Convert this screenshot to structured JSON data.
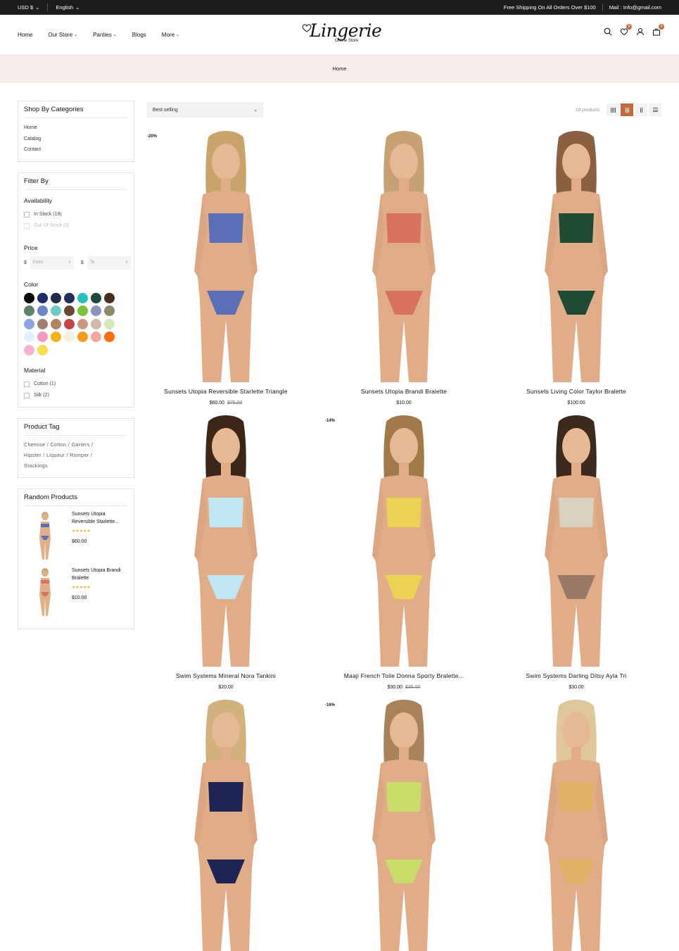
{
  "topbar": {
    "currency": "USD $",
    "language": "English",
    "shipping": "Free Shipping On All Orders Over $100",
    "mail": "Mail : Info@gmail.com"
  },
  "header": {
    "nav": [
      {
        "label": "Home",
        "dropdown": false
      },
      {
        "label": "Our Store",
        "dropdown": true
      },
      {
        "label": "Panties",
        "dropdown": true
      },
      {
        "label": "Blogs",
        "dropdown": false
      },
      {
        "label": "More",
        "dropdown": true
      }
    ],
    "logo_title": "Lingerie",
    "logo_subtitle": "Online Store",
    "wishlist_count": "0",
    "cart_count": "0",
    "accent": "#c8683e"
  },
  "breadcrumb": "Home",
  "sidebar": {
    "categories": {
      "title": "Shop By Categories",
      "links": [
        "Home",
        "Catalog",
        "Contact"
      ]
    },
    "filter": {
      "title": "Filter By",
      "availability_title": "Availability",
      "in_stock": "In Stock (19)",
      "out_of_stock": "Out Of Stock (0)",
      "price_title": "Price",
      "currency_symbol": "$",
      "from_placeholder": "From",
      "to_placeholder": "To",
      "color_title": "Color",
      "colors": [
        "#0a0a0a",
        "#1f2a6b",
        "#1f2b47",
        "#232a5c",
        "#26c1c1",
        "#1e4a3a",
        "#4a2e1f",
        "#5c8068",
        "#6b84c7",
        "#6fcac1",
        "#6b4632",
        "#7cc13a",
        "#8a93c0",
        "#8a8a66",
        "#8aa6da",
        "#a07f72",
        "#b08563",
        "#c0464a",
        "#c59a7f",
        "#d3b7a8",
        "#d4e8b8",
        "#dff0fa",
        "#f29ac0",
        "#f2b418",
        "#f4f0dc",
        "#f79a16",
        "#f5a59a",
        "#fb6b0f",
        "#f7b0d0",
        "#fddd4e"
      ],
      "material_title": "Material",
      "materials": [
        "Cotton (1)",
        "Silk (2)"
      ]
    },
    "tags": {
      "title": "Product Tag",
      "lines": [
        "Chemise /  Cotton /  Garters /",
        "Hipster /  Liqueur /  Romper /",
        "Stockings"
      ]
    },
    "random": {
      "title": "Random Products",
      "items": [
        {
          "name": "Sunsets Utopia Reversible Starlette...",
          "price": "$60.00",
          "stars": "★★★★★"
        },
        {
          "name": "Sunsets Utopia Brandi Bralette",
          "price": "$10.00",
          "stars": "★★★★★"
        }
      ]
    }
  },
  "toolbar": {
    "sort_label": "Best selling",
    "product_count": "19 products"
  },
  "products": [
    {
      "name": "Sunsets Utopia Reversible Starlette Triangle",
      "price": "$60.00",
      "old_price": "$75.00",
      "discount": "-20%",
      "top": "#5a6fb8",
      "bottom": "#5a6fb8",
      "hair": "#c9a46a"
    },
    {
      "name": "Sunsets Utopia Brandi Bralette",
      "price": "$10.00",
      "old_price": "",
      "discount": "",
      "top": "#d8735f",
      "bottom": "#d8735f",
      "hair": "#c7a173"
    },
    {
      "name": "Sunsets Living Color Taylor Bralette",
      "price": "$100.00",
      "old_price": "",
      "discount": "",
      "top": "#1f4a34",
      "bottom": "#1f4a34",
      "hair": "#8a6040"
    },
    {
      "name": "Swim Systems Mineral Nora Tankini",
      "price": "$20.00",
      "old_price": "",
      "discount": "",
      "top": "#bfe6f2",
      "bottom": "#bfe6f2",
      "hair": "#3b2618"
    },
    {
      "name": "Maaji French Toile Donna Sporty Bralette...",
      "price": "$30.00",
      "old_price": "$35.00",
      "discount": "-14%",
      "top": "#ead255",
      "bottom": "#ead255",
      "hair": "#a27a4a"
    },
    {
      "name": "Swim Systems Darling Ditsy Ayla Tri",
      "price": "$30.00",
      "old_price": "",
      "discount": "",
      "top": "#d9d2c0",
      "bottom": "#9a7a66",
      "hair": "#3d2a1e"
    },
    {
      "name": "",
      "price": "",
      "old_price": "",
      "discount": "",
      "top": "#1e2554",
      "bottom": "#1e2554",
      "hair": "#d2b27c"
    },
    {
      "name": "",
      "price": "",
      "old_price": "",
      "discount": "-16%",
      "top": "#c9dc6a",
      "bottom": "#c9dc6a",
      "hair": "#a88258"
    },
    {
      "name": "",
      "price": "",
      "old_price": "",
      "discount": "",
      "top": "#e3b067",
      "bottom": "#e3b067",
      "hair": "#e0c79b"
    }
  ]
}
